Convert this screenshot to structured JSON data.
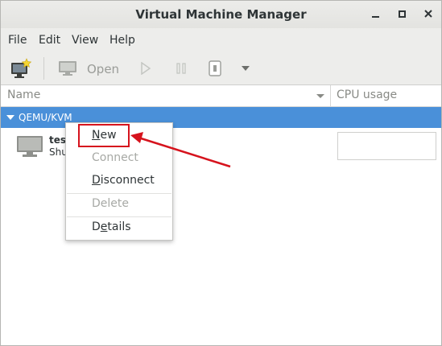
{
  "window": {
    "title": "Virtual Machine Manager"
  },
  "menubar": {
    "items": [
      "File",
      "Edit",
      "View",
      "Help"
    ]
  },
  "toolbar": {
    "open_label": "Open"
  },
  "columns": {
    "name": "Name",
    "cpu": "CPU usage"
  },
  "connection": {
    "label": "QEMU/KVM"
  },
  "vm": {
    "name": "test",
    "state": "Shu"
  },
  "context_menu": {
    "items": [
      {
        "label_first": "N",
        "label_rest": "ew",
        "enabled": true
      },
      {
        "label_first": "",
        "label_rest": "Connect",
        "enabled": false
      },
      {
        "label_first": "D",
        "label_rest": "isconnect",
        "enabled": true
      },
      {
        "label_first": "",
        "label_rest": "Delete",
        "enabled": false
      },
      {
        "label_first": "D",
        "label_rest": "etails",
        "enabled": true
      }
    ]
  },
  "colors": {
    "selection": "#4a90d9",
    "annotation": "#d6131d"
  },
  "icons": {
    "new_vm": "monitor-star-icon",
    "open": "monitor-icon",
    "run": "play-icon",
    "pause": "pause-icon",
    "shutdown": "power-icon",
    "dropdown": "chevron-down-icon",
    "vm": "monitor-icon"
  }
}
